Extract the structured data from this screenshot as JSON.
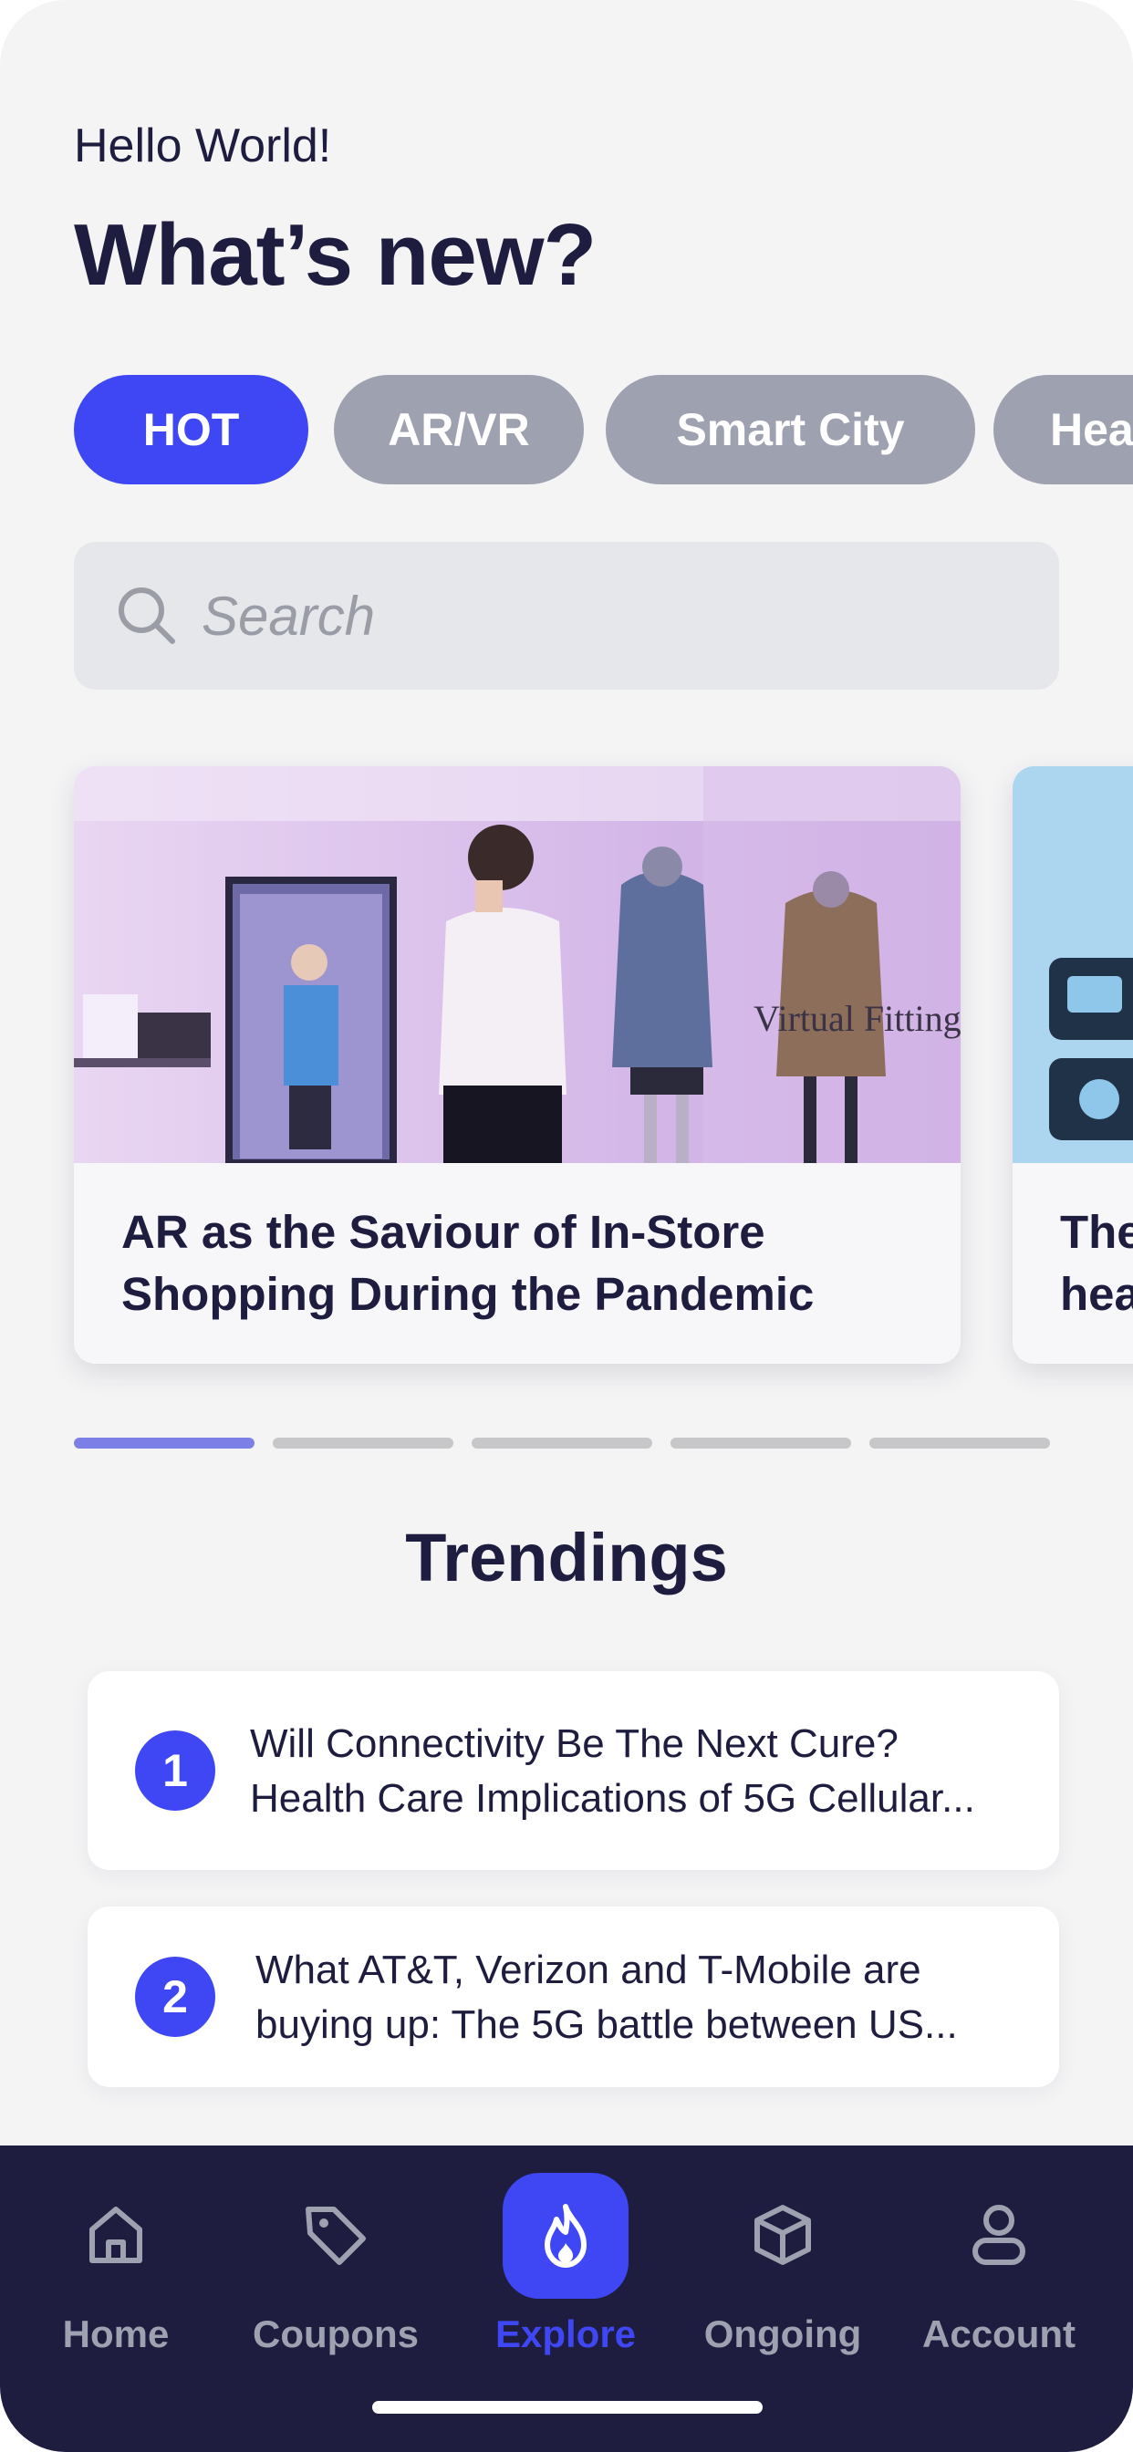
{
  "header": {
    "greeting": "Hello World!",
    "title": "What’s new?"
  },
  "categories": [
    {
      "label": "HOT",
      "active": true
    },
    {
      "label": "AR/VR",
      "active": false
    },
    {
      "label": "Smart City",
      "active": false
    },
    {
      "label": "Hea",
      "active": false
    }
  ],
  "search": {
    "placeholder": "Search",
    "value": ""
  },
  "featured": [
    {
      "title_line1": "AR as the Saviour of In-Store",
      "title_line2": "Shopping During the Pandemic",
      "image_text": "Virtual Fitting"
    },
    {
      "title_line1": "The",
      "title_line2": "hea"
    }
  ],
  "carousel": {
    "pages": 5,
    "active_index": 0
  },
  "trendings": {
    "title": "Trendings",
    "items": [
      {
        "rank": "1",
        "line1": "Will Connectivity Be The Next Cure?",
        "line2": "Health Care Implications of 5G Cellular..."
      },
      {
        "rank": "2",
        "line1": "What AT&T, Verizon and T-Mobile are",
        "line2": "buying up: The 5G battle between US..."
      }
    ]
  },
  "tabbar": {
    "items": [
      {
        "label": "Home",
        "icon": "home-icon",
        "active": false
      },
      {
        "label": "Coupons",
        "icon": "tag-icon",
        "active": false
      },
      {
        "label": "Explore",
        "icon": "flame-icon",
        "active": true
      },
      {
        "label": "Ongoing",
        "icon": "box-icon",
        "active": false
      },
      {
        "label": "Account",
        "icon": "user-icon",
        "active": false
      }
    ]
  },
  "colors": {
    "accent": "#3f47f5",
    "navy": "#1e1d3f",
    "chip_inactive": "#9ea1b0",
    "background": "#f4f4f5"
  }
}
